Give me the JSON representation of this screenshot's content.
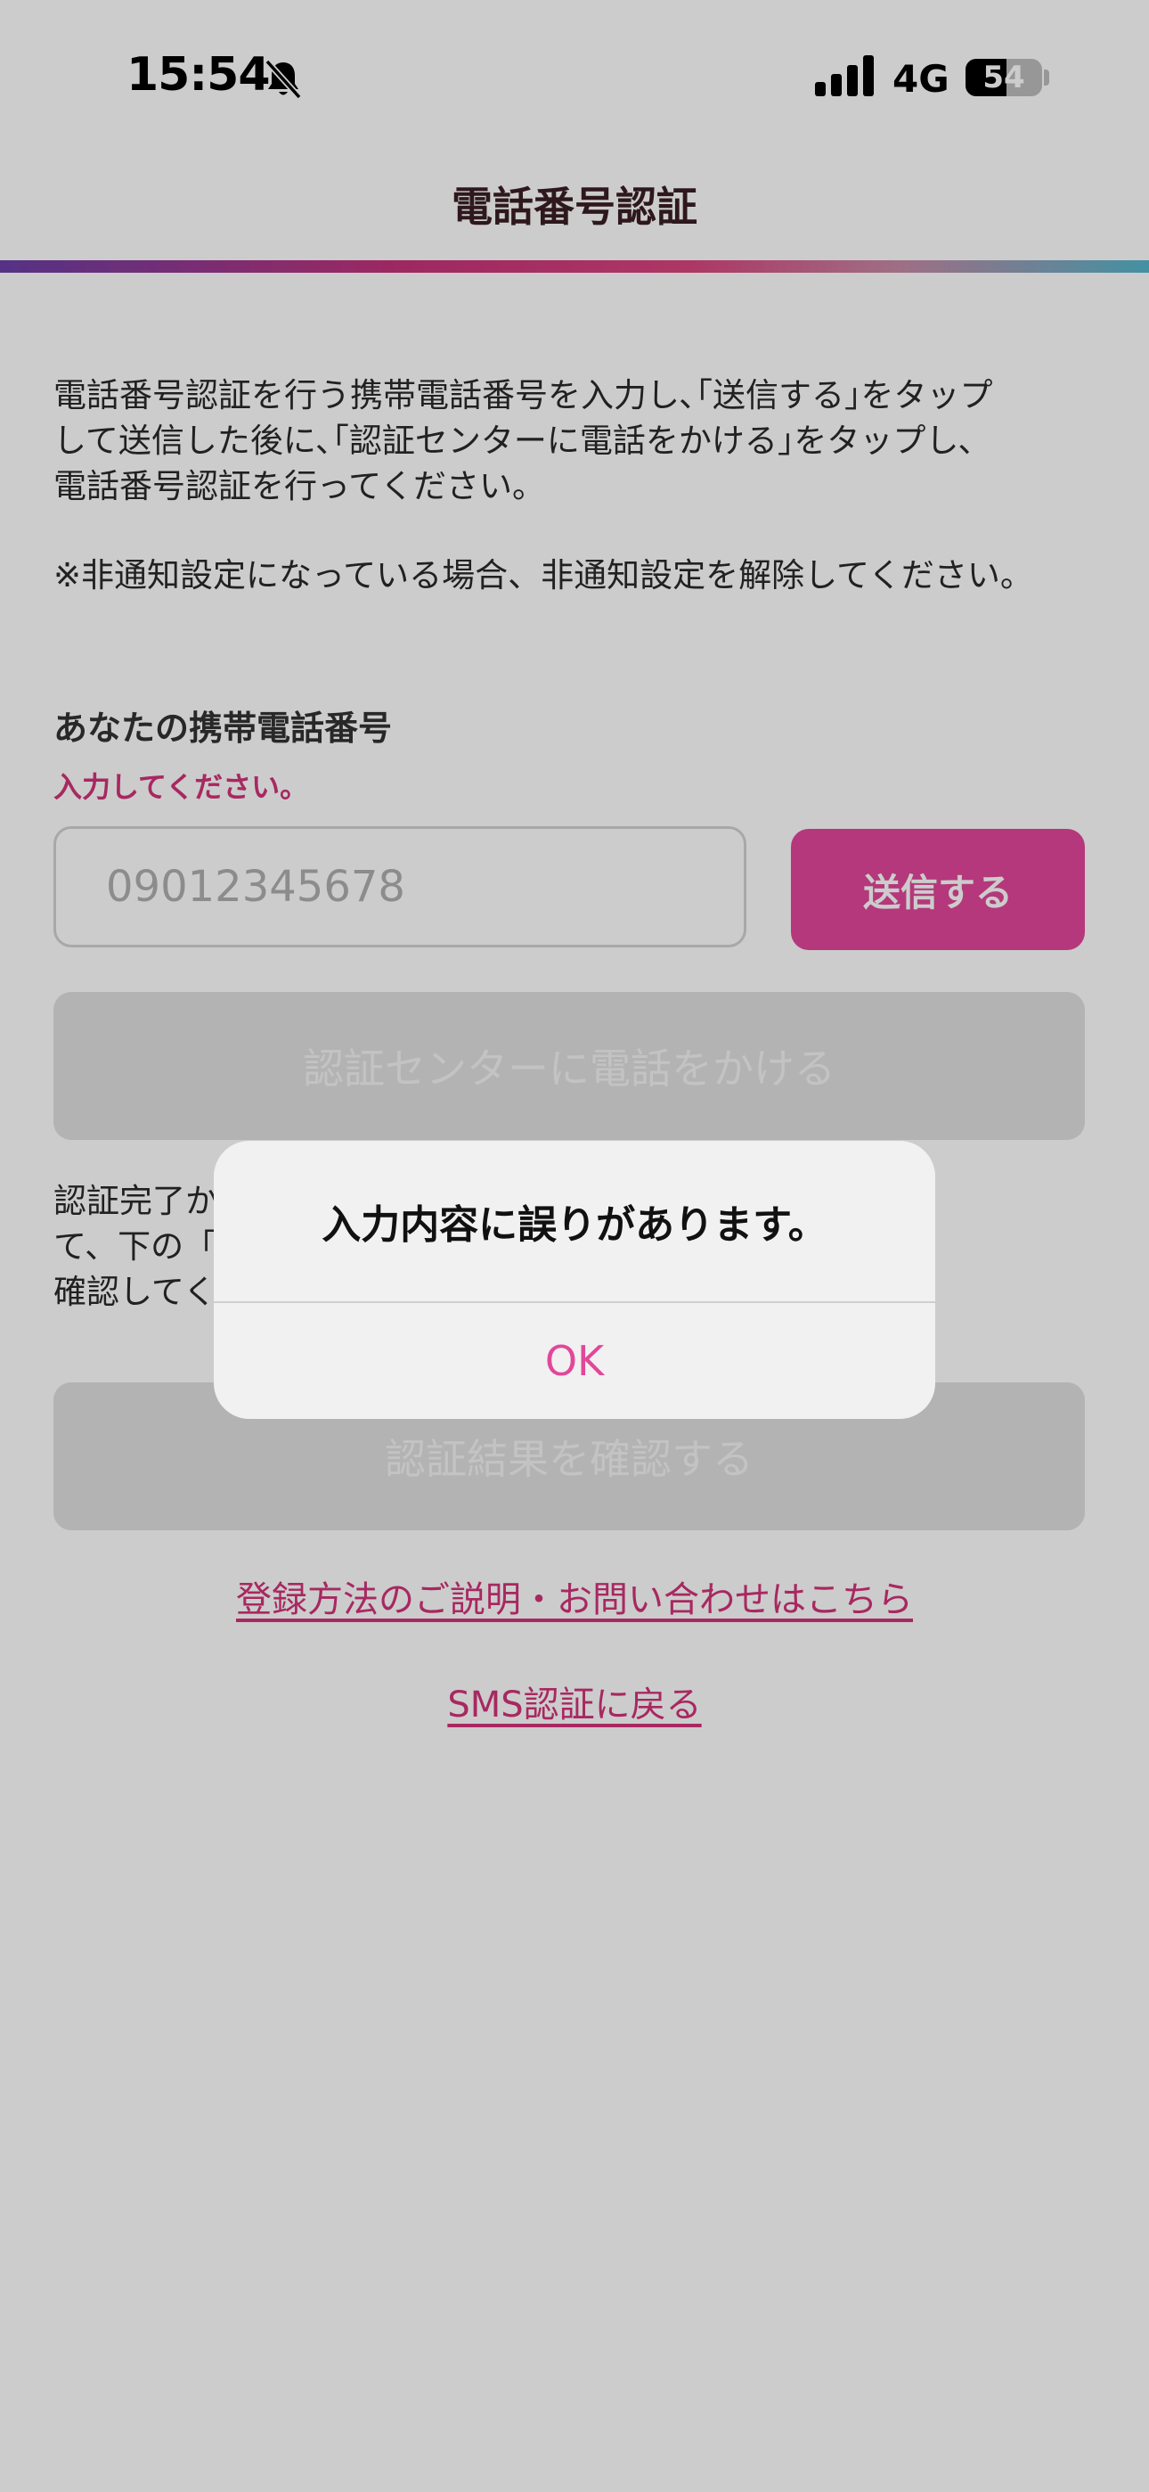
{
  "status_bar": {
    "time": "15:54",
    "network": "4G",
    "battery_level": "54",
    "battery_fraction": 0.54
  },
  "header": {
    "title": "電話番号認証"
  },
  "instructions": {
    "lines": [
      "電話番号認証を行う携帯電話番号を入力し､｢送信する｣をタップ",
      "して送信した後に､｢認証センターに電話をかける｣をタップし､",
      "電話番号認証を行ってください。"
    ],
    "note": "※非通知設定になっている場合、非通知設定を解除してください。"
  },
  "form": {
    "phone_label": "あなたの携帯電話番号",
    "error": "入力してください。",
    "phone_value": "",
    "phone_placeholder": "09012345678",
    "send_label": "送信する",
    "call_label": "認証センターに電話をかける"
  },
  "after_text": {
    "lines": [
      "認証完了かリに戻っ",
      "て、下の「証結果を",
      "確認してく"
    ]
  },
  "result_button": {
    "label": "認証結果を確認する"
  },
  "links": {
    "help": "登録方法のご説明・お問い合わせはこちら",
    "sms": "SMS認証に戻る"
  },
  "alert": {
    "message": "入力内容に誤りがあります。",
    "ok_label": "OK"
  },
  "colors": {
    "accent": "#e2479a",
    "error": "#d2337a",
    "disabled_button": "#e0e0e0"
  },
  "icons": {
    "bell": "bell-slash-icon",
    "signal": "cellular-signal-icon",
    "battery": "battery-icon"
  }
}
